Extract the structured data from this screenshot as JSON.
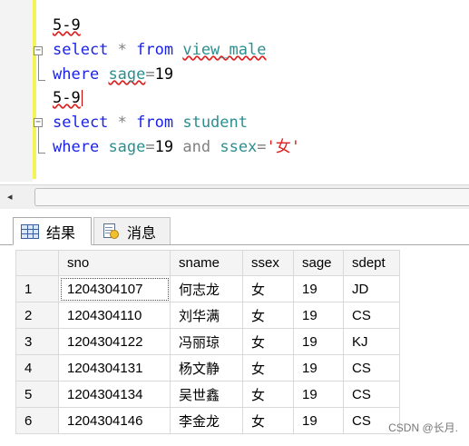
{
  "editor": {
    "lines": [
      {
        "text": "5-9"
      },
      {
        "kw1": "select",
        "op": " * ",
        "kw2": "from",
        "ident": "view_male"
      },
      {
        "kw1": "where",
        "ident": "sage",
        "op": "=",
        "num": "19"
      },
      {
        "text": "5-9"
      },
      {
        "kw1": "select",
        "op": " * ",
        "kw2": "from",
        "ident": "student"
      },
      {
        "kw1": "where",
        "ident": "sage",
        "op": "=",
        "num": "19",
        "kw2": "and",
        "ident2": "ssex",
        "op2": "=",
        "str": "'女'"
      }
    ]
  },
  "scrollbar": {
    "left_arrow": "◂"
  },
  "tabs": [
    {
      "label": "结果",
      "icon": "grid-icon",
      "active": true
    },
    {
      "label": "消息",
      "icon": "messages-icon",
      "active": false
    }
  ],
  "results": {
    "columns": [
      "sno",
      "sname",
      "ssex",
      "sage",
      "sdept"
    ],
    "rows": [
      {
        "num": "1",
        "sno": "1204304107",
        "sname": "何志龙",
        "ssex": "女",
        "sage": "19",
        "sdept": "JD"
      },
      {
        "num": "2",
        "sno": "1204304110",
        "sname": "刘华满",
        "ssex": "女",
        "sage": "19",
        "sdept": "CS"
      },
      {
        "num": "3",
        "sno": "1204304122",
        "sname": "冯丽琼",
        "ssex": "女",
        "sage": "19",
        "sdept": "KJ"
      },
      {
        "num": "4",
        "sno": "1204304131",
        "sname": "杨文静",
        "ssex": "女",
        "sage": "19",
        "sdept": "CS"
      },
      {
        "num": "5",
        "sno": "1204304134",
        "sname": "吴世鑫",
        "ssex": "女",
        "sage": "19",
        "sdept": "CS"
      },
      {
        "num": "6",
        "sno": "1204304146",
        "sname": "李金龙",
        "ssex": "女",
        "sage": "19",
        "sdept": "CS"
      }
    ]
  },
  "watermark": "CSDN @长月."
}
